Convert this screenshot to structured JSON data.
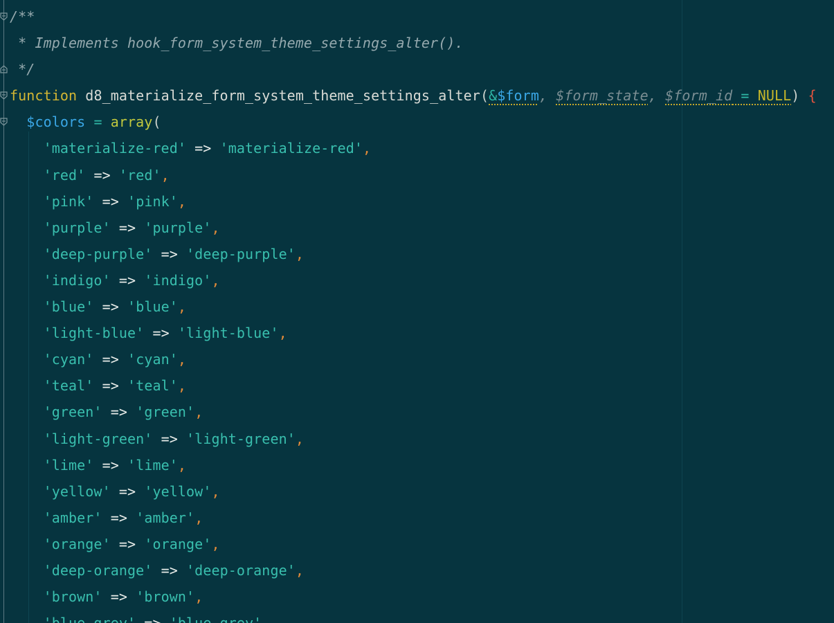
{
  "editor": {
    "colors": {
      "background": "#06343f",
      "comment": "#95a9ae",
      "keyword": "#d4b633",
      "string": "#39bfae",
      "variable": "#3aa7e6",
      "comma": "#e08a3a",
      "brace": "#e0533e"
    },
    "comment": {
      "open": "/**",
      "body": " * Implements hook_form_system_theme_settings_alter().",
      "close": " */"
    },
    "signature": {
      "keyword": "function",
      "name": "d8_materialize_form_system_theme_settings_alter",
      "open_paren": "(",
      "amp": "&",
      "param1": "$form",
      "sep1": ", ",
      "param2": "$form_state",
      "sep2": ", ",
      "param3": "$form_id",
      "assign": " = ",
      "default": "NULL",
      "close_paren": ")",
      "brace": "{"
    },
    "colors_decl": {
      "var": "$colors",
      "assign": " = ",
      "fn": "array",
      "paren": "("
    },
    "arrow": "=>",
    "entries": [
      {
        "key": "'materialize-red'",
        "value": "'materialize-red'"
      },
      {
        "key": "'red'",
        "value": "'red'"
      },
      {
        "key": "'pink'",
        "value": "'pink'"
      },
      {
        "key": "'purple'",
        "value": "'purple'"
      },
      {
        "key": "'deep-purple'",
        "value": "'deep-purple'"
      },
      {
        "key": "'indigo'",
        "value": "'indigo'"
      },
      {
        "key": "'blue'",
        "value": "'blue'"
      },
      {
        "key": "'light-blue'",
        "value": "'light-blue'"
      },
      {
        "key": "'cyan'",
        "value": "'cyan'"
      },
      {
        "key": "'teal'",
        "value": "'teal'"
      },
      {
        "key": "'green'",
        "value": "'green'"
      },
      {
        "key": "'light-green'",
        "value": "'light-green'"
      },
      {
        "key": "'lime'",
        "value": "'lime'"
      },
      {
        "key": "'yellow'",
        "value": "'yellow'"
      },
      {
        "key": "'amber'",
        "value": "'amber'"
      },
      {
        "key": "'orange'",
        "value": "'orange'"
      },
      {
        "key": "'deep-orange'",
        "value": "'deep-orange'"
      },
      {
        "key": "'brown'",
        "value": "'brown'"
      },
      {
        "key": "'blue-grey'",
        "value": "'blue-grey'"
      }
    ]
  }
}
